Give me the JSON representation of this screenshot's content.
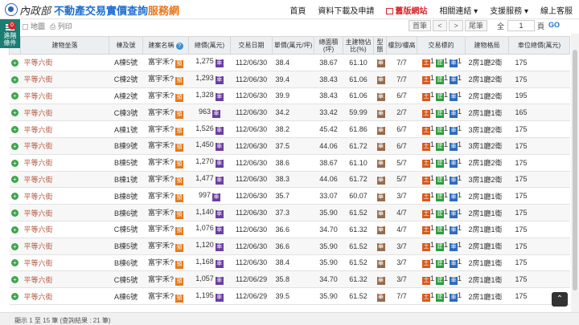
{
  "header": {
    "ministry": "內政部",
    "site_title": "不動產交易實價查詢",
    "site_title2": "服務網",
    "nav": [
      "首頁",
      "資料下載及申請",
      "舊版網站",
      "相關連結",
      "支援服務",
      "線上客服"
    ]
  },
  "toolbar": {
    "map": "地圖",
    "print": "列印",
    "first_page": "首筆",
    "prev": "<",
    "next": ">",
    "last_page": "尾筆",
    "total_label": "全",
    "page_value": "1",
    "page_unit": "頁",
    "go": "GO"
  },
  "side": {
    "badge": "0",
    "label1": "進階",
    "label2": "條件"
  },
  "columns": [
    "建物坐落",
    "棟及號",
    "建案名稱",
    "總價(萬元)",
    "交易日期",
    "單價(萬元/坪)",
    "總面積(坪)",
    "主建物佔比(%)",
    "型態",
    "樓別/樓高",
    "交易標的",
    "建物格局",
    "車位總價(萬元)"
  ],
  "rows": [
    [
      "平等六街",
      "A棟5號",
      "富宇禾?",
      "1,275",
      "112/06/30",
      "38.4",
      "38.67",
      "61.10",
      "7/7",
      "2房1廳2衛",
      "175"
    ],
    [
      "平等六街",
      "C棟2號",
      "富宇禾?",
      "1,293",
      "112/06/30",
      "39.4",
      "38.43",
      "61.06",
      "7/7",
      "2房1廳2衛",
      "175"
    ],
    [
      "平等六街",
      "A棟2號",
      "富宇禾?",
      "1,328",
      "112/06/30",
      "39.9",
      "38.43",
      "61.06",
      "6/7",
      "2房1廳2衛",
      "195"
    ],
    [
      "平等六街",
      "C棟3號",
      "富宇禾?",
      "963",
      "112/06/30",
      "34.2",
      "33.42",
      "59.99",
      "2/7",
      "2房1廳1衛",
      "165"
    ],
    [
      "平等六街",
      "A棟1號",
      "富宇禾?",
      "1,526",
      "112/06/30",
      "38.2",
      "45.42",
      "61.86",
      "6/7",
      "3房1廳2衛",
      "175"
    ],
    [
      "平等六街",
      "B棟9號",
      "富宇禾?",
      "1,450",
      "112/06/30",
      "37.5",
      "44.06",
      "61.72",
      "6/7",
      "3房1廳2衛",
      "175"
    ],
    [
      "平等六街",
      "B棟5號",
      "富宇禾?",
      "1,270",
      "112/06/30",
      "38.6",
      "38.67",
      "61.10",
      "5/7",
      "2房1廳2衛",
      "175"
    ],
    [
      "平等六街",
      "B棟1號",
      "富宇禾?",
      "1,477",
      "112/06/30",
      "38.3",
      "44.06",
      "61.72",
      "5/7",
      "3房1廳2衛",
      "175"
    ],
    [
      "平等六街",
      "B棟8號",
      "富宇禾?",
      "997",
      "112/06/30",
      "35.7",
      "33.07",
      "60.07",
      "3/7",
      "2房1廳1衛",
      "175"
    ],
    [
      "平等六街",
      "B棟6號",
      "富宇禾?",
      "1,140",
      "112/06/30",
      "37.3",
      "35.90",
      "61.52",
      "4/7",
      "2房1廳1衛",
      "175"
    ],
    [
      "平等六街",
      "C棟5號",
      "富宇禾?",
      "1,076",
      "112/06/30",
      "36.6",
      "34.70",
      "61.32",
      "4/7",
      "2房1廳1衛",
      "175"
    ],
    [
      "平等六街",
      "B棟5號",
      "富宇禾?",
      "1,120",
      "112/06/30",
      "36.6",
      "35.90",
      "61.52",
      "3/7",
      "2房1廳1衛",
      "175"
    ],
    [
      "平等六街",
      "B棟6號",
      "富宇禾?",
      "1,168",
      "112/06/30",
      "38.4",
      "35.90",
      "61.52",
      "3/7",
      "2房1廳1衛",
      "175"
    ],
    [
      "平等六街",
      "C棟5號",
      "富宇禾?",
      "1,057",
      "112/06/29",
      "35.8",
      "34.70",
      "61.32",
      "3/7",
      "2房1廳1衛",
      "175"
    ],
    [
      "平等六街",
      "A棟6號",
      "富宇禾?",
      "1,195",
      "112/06/29",
      "39.5",
      "35.90",
      "61.52",
      "7/7",
      "2房1廳1衛",
      "175"
    ]
  ],
  "icons": {
    "price_tag": "車",
    "presale": "預",
    "type_tag": "華",
    "land": "土",
    "bldg": "建",
    "park": "車"
  },
  "footer": {
    "text": "顯示 1 至 15 筆 (查詢結果 : 21 筆)"
  }
}
